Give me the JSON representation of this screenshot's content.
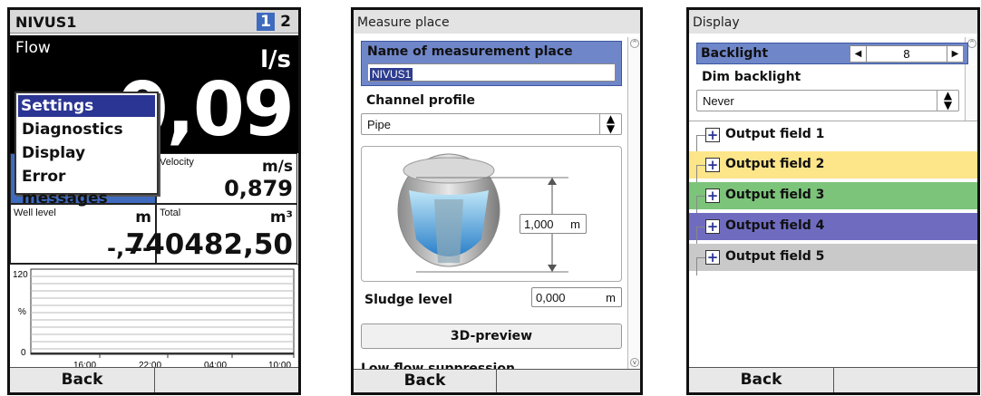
{
  "screen1": {
    "title": "NIVUS1",
    "pages": [
      "1",
      "2"
    ],
    "flow": {
      "label": "Flow",
      "unit": "l/s",
      "value": "0,09"
    },
    "menu": [
      "Settings",
      "Diagnostics",
      "Display",
      "Error messages"
    ],
    "velocity": {
      "label": "Velocity",
      "unit": "m/s",
      "value": "0,879"
    },
    "well_level": {
      "label": "Well level",
      "unit": "m",
      "value": "-,---"
    },
    "total": {
      "label": "Total",
      "unit": "m³",
      "value": "740482,50"
    },
    "graph": {
      "y_max": "120",
      "y_unit": "%",
      "y_min": "0",
      "x_ticks": [
        "16:00",
        "22:00",
        "04:00",
        "10:00"
      ]
    },
    "softkeys": [
      "Back",
      ""
    ]
  },
  "screen2": {
    "title": "Measure place",
    "name_label": "Name of measurement place",
    "name_value": "NIVUS1",
    "profile_label": "Channel profile",
    "profile_value": "Pipe",
    "diameter_value": "1,000",
    "diameter_unit": "m",
    "sludge_label": "Sludge level",
    "sludge_value": "0,000",
    "sludge_unit": "m",
    "preview_button": "3D-preview",
    "next_label": "Low flow suppression",
    "softkeys": [
      "Back",
      ""
    ]
  },
  "screen3": {
    "title": "Display",
    "backlight_label": "Backlight",
    "backlight_value": "8",
    "dim_label": "Dim backlight",
    "dim_value": "Never",
    "output_fields": [
      {
        "label": "Output field 1",
        "color": "#ffffff"
      },
      {
        "label": "Output field 2",
        "color": "#fde58a"
      },
      {
        "label": "Output field 3",
        "color": "#7cc47a"
      },
      {
        "label": "Output field 4",
        "color": "#6f6cc0"
      },
      {
        "label": "Output field 5",
        "color": "#c9c9c9"
      }
    ],
    "softkeys": [
      "Back",
      ""
    ]
  }
}
